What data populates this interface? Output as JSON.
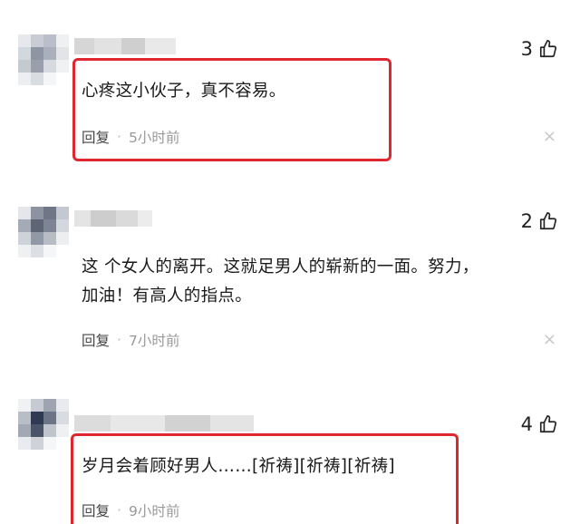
{
  "comments": [
    {
      "likes": "3",
      "text": "心疼这小伙子，真不容易。",
      "reply_label": "回复",
      "separator": "·",
      "time": "5小时前",
      "close": "×"
    },
    {
      "likes": "2",
      "text_line1": "这 个女人的离开。这就足男人的崭新的一面。努力，",
      "text_line2": "加油！有高人的指点。",
      "reply_label": "回复",
      "separator": "·",
      "time": "7小时前",
      "close": "×"
    },
    {
      "likes": "4",
      "text": "岁月会着顾好男人……[祈祷][祈祷][祈祷]",
      "reply_label": "回复",
      "separator": "·",
      "time": "9小时前"
    }
  ],
  "colors": {
    "highlight": "#e0272f",
    "time": "#999999"
  },
  "icons": {
    "like": "thumbs-up-icon",
    "close": "close-icon"
  }
}
